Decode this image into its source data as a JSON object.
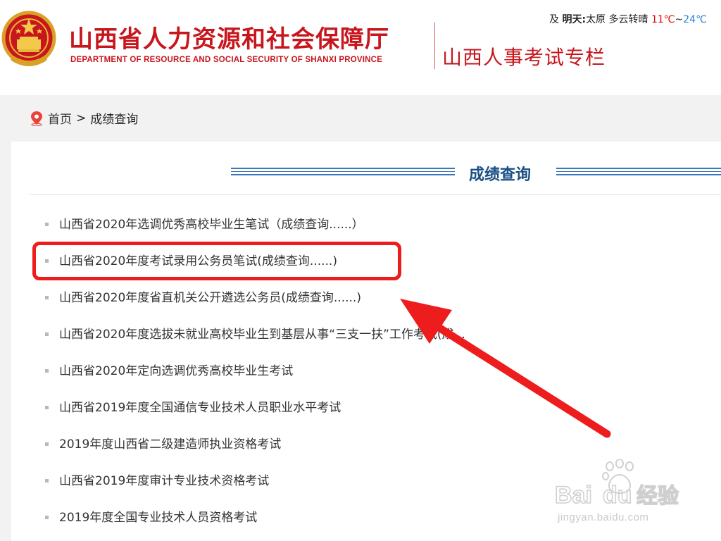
{
  "header": {
    "title_cn": "山西省人力资源和社会保障厅",
    "title_en": "DEPARTMENT OF RESOURCE AND SOCIAL SECURITY OF SHANXI PROVINCE",
    "subtitle": "山西人事考试专栏",
    "weather": {
      "prefix": "及",
      "label": "明天:",
      "city": "太原",
      "condition": "多云转晴",
      "low": "11℃",
      "sep": "~",
      "high": "24℃"
    }
  },
  "breadcrumb": {
    "home": "首页",
    "sep": ">",
    "current": "成绩查询"
  },
  "section": {
    "title": "成绩查询"
  },
  "items": [
    "山西省2020年选调优秀高校毕业生笔试（成绩查询......）",
    "山西省2020年度考试录用公务员笔试(成绩查询......)",
    "山西省2020年度省直机关公开遴选公务员(成绩查询......)",
    "山西省2020年度选拔未就业高校毕业生到基层从事“三支一扶”工作考试(成...",
    "山西省2020年定向选调优秀高校毕业生考试",
    "山西省2019年度全国通信专业技术人员职业水平考试",
    "2019年度山西省二级建造师执业资格考试",
    "山西省2019年度审计专业技术资格考试",
    "2019年度全国专业技术人员资格考试"
  ],
  "watermark": {
    "brand": "Bai",
    "brand2": "du",
    "brand_cn": "经验",
    "url": "jingyan.baidu.com"
  },
  "colors": {
    "brand_red": "#c8161d",
    "title_blue": "#1a4f86",
    "highlight": "#ee1d1d"
  },
  "icons": {
    "emblem": "national-emblem-icon",
    "location": "location-pin-icon",
    "arrow": "red-arrow-annotation"
  }
}
